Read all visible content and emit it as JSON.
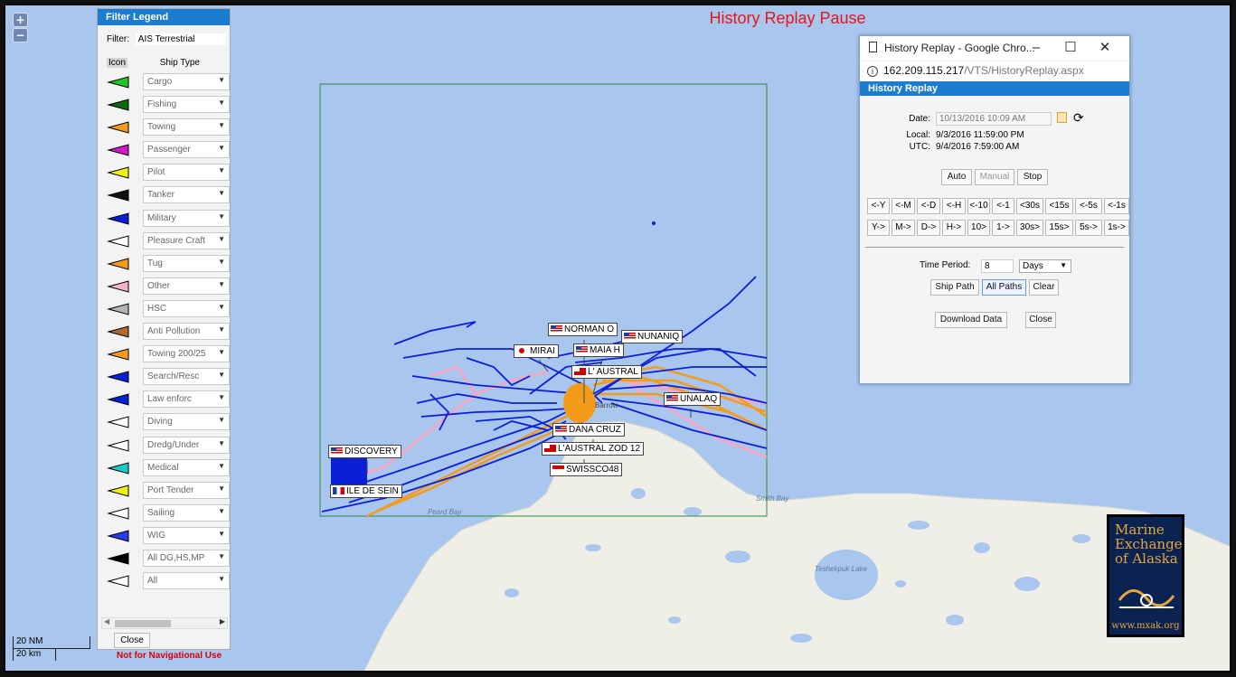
{
  "banner": "History Replay Pause",
  "zoom": {
    "in": "+",
    "out": "−"
  },
  "legend": {
    "title": "Filter Legend",
    "filter_label": "Filter:",
    "filter_value": "AIS Terrestrial",
    "col_icon": "Icon",
    "col_type": "Ship Type",
    "close": "Close",
    "items": [
      {
        "label": "Cargo",
        "color": "#25c425"
      },
      {
        "label": "Fishing",
        "color": "#0b6b0b"
      },
      {
        "label": "Towing",
        "color": "#f59b1a"
      },
      {
        "label": "Passenger",
        "color": "#d517c9"
      },
      {
        "label": "Pilot",
        "color": "#efef15"
      },
      {
        "label": "Tanker",
        "color": "#111111"
      },
      {
        "label": "Military",
        "color": "#0b1fd9"
      },
      {
        "label": "Pleasure Craft",
        "color": "#ffffff"
      },
      {
        "label": "Tug",
        "color": "#f59b1a"
      },
      {
        "label": "Other",
        "color": "#f3b3c8"
      },
      {
        "label": "HSC",
        "color": "#b5b5b5"
      },
      {
        "label": "Anti Pollution",
        "color": "#b26a2b"
      },
      {
        "label": "Towing 200/25",
        "color": "#f59b1a"
      },
      {
        "label": "Search/Resc",
        "color": "#0b1fd9"
      },
      {
        "label": "Law enforc",
        "color": "#0b1fd9"
      },
      {
        "label": "Diving",
        "color": "#ffffff"
      },
      {
        "label": "Dredg/Under",
        "color": "#ffffff"
      },
      {
        "label": "Medical",
        "color": "#18c9c9"
      },
      {
        "label": "Port Tender",
        "color": "#efef15"
      },
      {
        "label": "Sailing",
        "color": "#ffffff"
      },
      {
        "label": "WIG",
        "color": "#2a3ae8"
      },
      {
        "label": "All DG,HS,MP",
        "color": "#000000"
      },
      {
        "label": "All",
        "color": "#ffffff"
      }
    ]
  },
  "scale": {
    "nm": "20 NM",
    "km": "20 km"
  },
  "not_for_nav": "Not for Navigational Use",
  "map": {
    "places": [
      "Barrow",
      "Peard Bay",
      "Smith Bay",
      "Teshekpuk Lake"
    ],
    "vessels": [
      {
        "name": "NORMAN O",
        "flag": "us"
      },
      {
        "name": "NUNANIQ",
        "flag": "us"
      },
      {
        "name": "MIRAI",
        "flag": "jp"
      },
      {
        "name": "MAIA H",
        "flag": "us"
      },
      {
        "name": "L' AUSTRAL",
        "flag": "bm"
      },
      {
        "name": "UNALAQ",
        "flag": "us"
      },
      {
        "name": "DANA CRUZ",
        "flag": "us"
      },
      {
        "name": "L'AUSTRAL ZOD 12",
        "flag": "bm"
      },
      {
        "name": "SWISSCO48",
        "flag": "id"
      },
      {
        "name": "DISCOVERY",
        "flag": "us"
      },
      {
        "name": "ILE DE SEIN",
        "flag": "fr"
      }
    ]
  },
  "window": {
    "title": "History Replay - Google Chro...",
    "url_host": "162.209.115.217",
    "url_path": "/VTS/HistoryReplay.aspx",
    "header": "History Replay",
    "date_label": "Date:",
    "date_value": "10/13/2016 10:09 AM",
    "local_label": "Local:",
    "local_value": "9/3/2016 11:59:00 PM",
    "utc_label": "UTC:",
    "utc_value": "9/4/2016 7:59:00 AM",
    "mode_buttons": [
      "Auto",
      "Manual",
      "Stop"
    ],
    "back_steps": [
      "<-Y",
      "<-M",
      "<-D",
      "<-H",
      "<-10",
      "<-1",
      "<30s",
      "<15s",
      "<-5s",
      "<-1s"
    ],
    "fwd_steps": [
      "Y->",
      "M->",
      "D->",
      "H->",
      "10>",
      "1->",
      "30s>",
      "15s>",
      "5s->",
      "1s->"
    ],
    "period_label": "Time Period:",
    "period_value": "8",
    "period_unit": "Days",
    "path_buttons": [
      "Ship Path",
      "All Paths",
      "Clear"
    ],
    "download": "Download Data",
    "close": "Close"
  },
  "logo": {
    "line1": "Marine",
    "line2": "Exchange",
    "line3": "of Alaska",
    "url": "www.mxak.org"
  }
}
